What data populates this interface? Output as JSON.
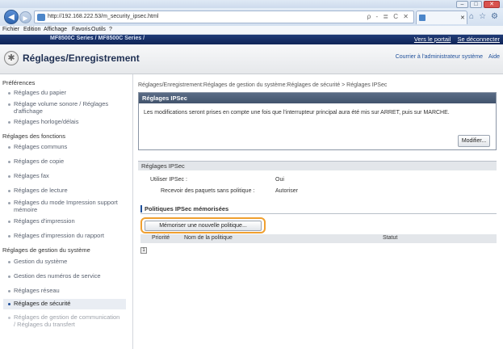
{
  "browser": {
    "address": "http://192.168.222.53/m_security_ipsec.html",
    "address_actions": "ρ - ≣ C ✕",
    "tab_label": "",
    "tools": [
      "⌂",
      "☆",
      "⚙"
    ],
    "window_buttons": [
      "–",
      "□",
      "✕"
    ]
  },
  "menubar": [
    "Fichier",
    "Edition",
    "Affichage",
    "Favoris",
    "Outils",
    "?"
  ],
  "device": {
    "model": "MF8500C Series / MF8500C Series /",
    "links": [
      "Vers le portail",
      "Se déconnecter"
    ]
  },
  "app": {
    "title": "Réglages/Enregistrement",
    "links": [
      "Courrier à l'administrateur système",
      "Aide"
    ]
  },
  "sidebar": {
    "groups": [
      {
        "label": "Préférences",
        "items": [
          "Réglages du papier",
          "Réglage volume sonore / Réglages d'affichage",
          "Réglages horloge/délais"
        ]
      },
      {
        "label": "Réglages des fonctions",
        "items": [
          "Réglages communs",
          "Réglages de copie",
          "Réglages fax",
          "Réglages de lecture",
          "Réglages du mode Impression support mémoire",
          "Réglages d'impression",
          "Réglages d'impression du rapport"
        ]
      },
      {
        "label": "Réglages de gestion du système",
        "items": [
          "Gestion du système",
          "Gestion des numéros de service",
          "Réglages réseau",
          "Réglages de sécurité",
          "Réglages de gestion de communication / Réglages du transfert"
        ]
      }
    ]
  },
  "main": {
    "breadcrumb": "Réglages/Enregistrement:Réglages de gestion du système:Réglages de sécurité > Réglages IPSec",
    "panel_title": "Réglages IPSec",
    "panel_note": "Les modifications seront prises en compte une fois que l'interrupteur principal aura été mis sur ARRET, puis sur MARCHE.",
    "modify_button": "Modifier...",
    "section_title": "Réglages IPSec",
    "rows": [
      {
        "label": "Utiliser IPSec :",
        "value": "Oui"
      },
      {
        "label": "Recevoir des paquets sans politique :",
        "value": "Autoriser"
      }
    ],
    "policies_title": "Politiques IPSec mémorisées",
    "register_button": "Mémoriser une nouvelle politique...",
    "table_headers": [
      "Priorité",
      "Nom de la politique",
      "Statut"
    ],
    "pager": "1"
  },
  "colors": {
    "device_bar": "#1f3b77",
    "highlight": "#f0a030"
  }
}
